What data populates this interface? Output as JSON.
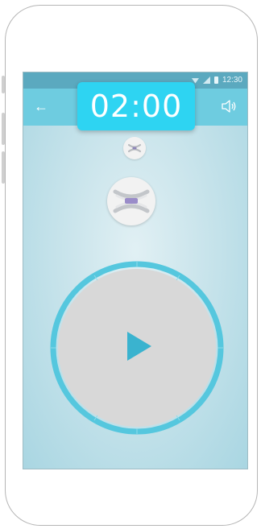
{
  "status_bar": {
    "time": "12:30"
  },
  "toolbar": {
    "back_icon": "arrow-left-icon",
    "sound_icon": "speaker-icon"
  },
  "timer": {
    "display": "02:00"
  },
  "exercise_icons": {
    "small": "exercise-small-icon",
    "large": "exercise-large-icon"
  },
  "player": {
    "play_icon": "play-icon",
    "ring_color": "#55c7de"
  },
  "colors": {
    "accent": "#2ed4f2",
    "toolbar": "#6ecce0",
    "statusbar": "#5ba9bf"
  }
}
